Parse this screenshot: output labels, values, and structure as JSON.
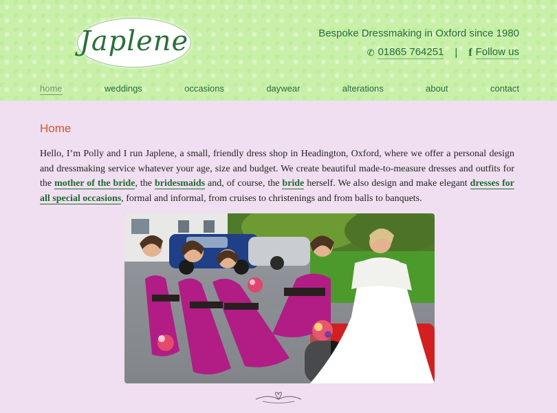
{
  "logo": {
    "text": "Japlene"
  },
  "tagline": "Bespoke Dressmaking in Oxford since 1980",
  "contact": {
    "phone": "01865 764251",
    "phone_icon": "phone-icon",
    "separator": "|",
    "social": "Follow us",
    "social_icon": "facebook-icon"
  },
  "nav": {
    "items": [
      {
        "label": "home",
        "active": true
      },
      {
        "label": "weddings"
      },
      {
        "label": "occasions"
      },
      {
        "label": "daywear"
      },
      {
        "label": "alterations"
      },
      {
        "label": "about"
      },
      {
        "label": "contact"
      }
    ]
  },
  "main": {
    "title": "Home",
    "intro": {
      "t1": "Hello, I’m Polly and I run Japlene, a small, friendly dress shop in Headington, Oxford, where we offer a personal design and dressmaking service whatever your age, size and budget. We create beautiful made-to-measure dresses and outfits for the ",
      "l1": "mother of the bride",
      "t2": ", the ",
      "l2": "bridesmaids",
      "t3": " and, of course, the ",
      "l3": "bride",
      "t4": " herself. We also design and make elegant ",
      "l4": "dresses for all special occasions",
      "t5": ", formal and informal, from cruises to christenings and from balls to banquets."
    }
  },
  "colors": {
    "header_bg": "#c8f0a8",
    "page_bg": "#f0dff0",
    "link": "#1d6a2d",
    "heading": "#d4532a",
    "nav": "#256b39",
    "nav_active": "#70966f"
  }
}
